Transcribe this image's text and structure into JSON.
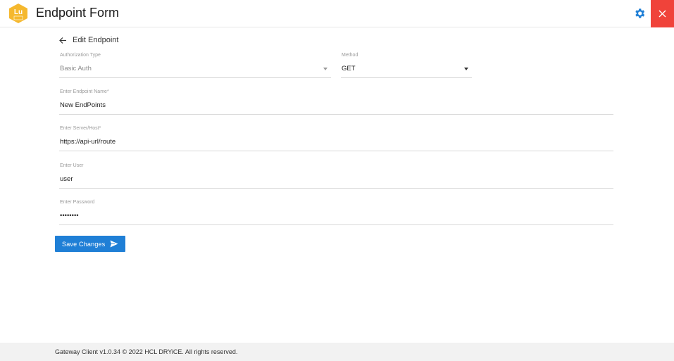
{
  "app": {
    "logo_text": "Lu",
    "title": "Endpoint Form"
  },
  "header": {
    "back_label": "Edit Endpoint"
  },
  "form": {
    "auth_type": {
      "label": "Authorization Type",
      "value": "Basic Auth"
    },
    "method": {
      "label": "Method",
      "value": "GET"
    },
    "endpoint_name": {
      "label": "Enter Endpoint Name*",
      "value": "New EndPoints"
    },
    "server_host": {
      "label": "Enter Server/Host*",
      "value": "https://api-url/route"
    },
    "user": {
      "label": "Enter User",
      "value": "user"
    },
    "password": {
      "label": "Enter Password",
      "value": "••••••••"
    },
    "save_label": "Save Changes"
  },
  "footer": {
    "text": "Gateway Client v1.0.34 © 2022 HCL DRYiCE. All rights reserved."
  },
  "colors": {
    "accent": "#1f7fd6",
    "close": "#f0433a",
    "logo": "#f5b82e"
  }
}
